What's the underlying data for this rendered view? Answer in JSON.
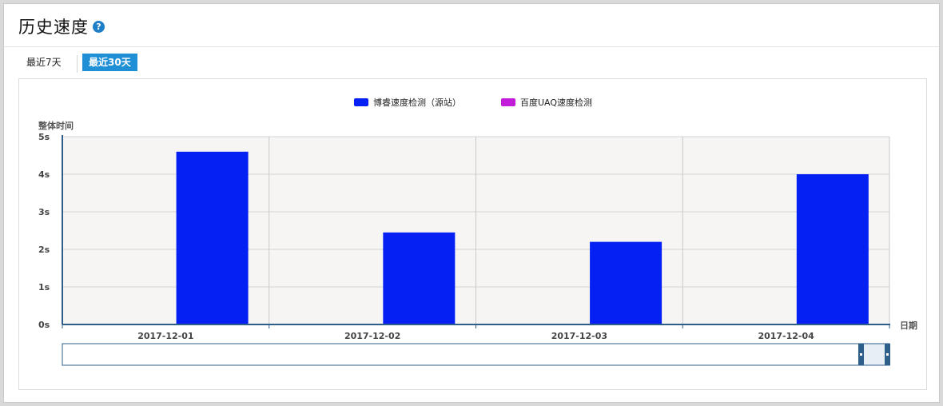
{
  "header": {
    "title": "历史速度",
    "help_icon": "question-circle-icon"
  },
  "tabs": [
    {
      "label": "最近7天",
      "active": false
    },
    {
      "label": "最近30天",
      "active": true
    }
  ],
  "chart_data": {
    "type": "bar",
    "ylabel": "整体时间",
    "xlabel": "日期",
    "ylim": [
      0,
      5
    ],
    "y_ticks": [
      "0s",
      "1s",
      "2s",
      "3s",
      "4s",
      "5s"
    ],
    "categories": [
      "2017-12-01",
      "2017-12-02",
      "2017-12-03",
      "2017-12-04"
    ],
    "series": [
      {
        "name": "博睿速度检测（源站）",
        "color": "#0520f2",
        "values": [
          4.6,
          2.45,
          2.2,
          4.0
        ]
      },
      {
        "name": "百度UAQ速度检测",
        "color": "#c21ed9",
        "values": []
      }
    ],
    "legend_position": "top-center",
    "grid": true
  }
}
